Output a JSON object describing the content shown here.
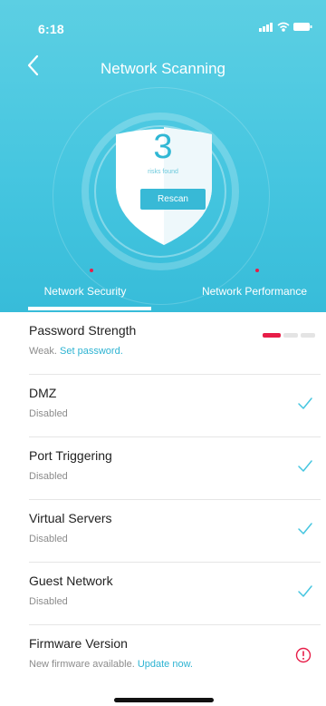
{
  "status_bar": {
    "time": "6:18"
  },
  "header": {
    "title": "Network Scanning"
  },
  "scan": {
    "count": "3",
    "risk_label": "risks found",
    "rescan_label": "Rescan"
  },
  "tabs": [
    {
      "label": "Network Security",
      "selected": true,
      "has_alert": true
    },
    {
      "label": "Network Performance",
      "selected": false,
      "has_alert": true
    }
  ],
  "items": [
    {
      "title": "Password Strength",
      "sub": "Weak.",
      "link": "Set password.",
      "status": "strength",
      "strength_level": 1,
      "strength_segments": 3
    },
    {
      "title": "DMZ",
      "sub": "Disabled",
      "status": "ok"
    },
    {
      "title": "Port Triggering",
      "sub": "Disabled",
      "status": "ok"
    },
    {
      "title": "Virtual Servers",
      "sub": "Disabled",
      "status": "ok"
    },
    {
      "title": "Guest Network",
      "sub": "Disabled",
      "status": "ok"
    },
    {
      "title": "Firmware Version",
      "sub": "New firmware available.",
      "link": "Update now.",
      "status": "alert"
    }
  ],
  "colors": {
    "accent": "#2db3d2",
    "alert": "#e71d48",
    "ok": "#46c6e0"
  }
}
